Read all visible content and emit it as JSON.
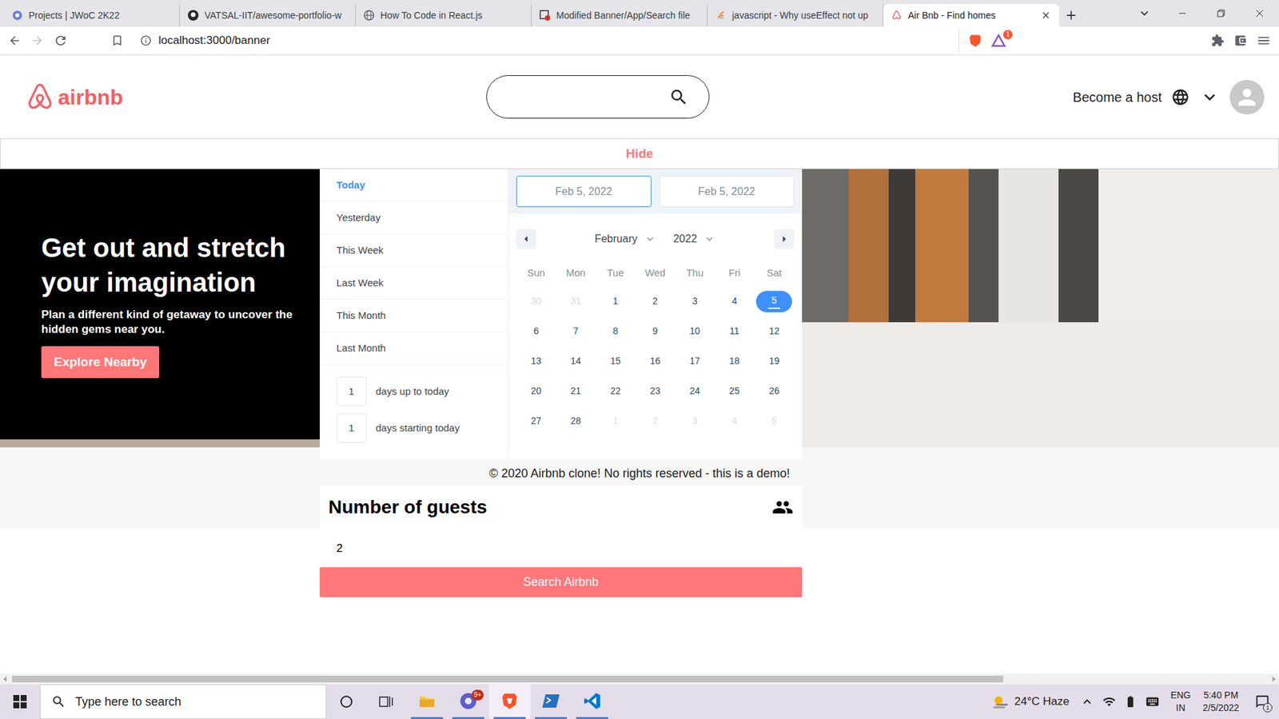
{
  "browser": {
    "tabs": [
      {
        "label": "Projects | JWoC 2K22",
        "selected": false,
        "kind": "jwoc"
      },
      {
        "label": "VATSAL-IIT/awesome-portfolio-w",
        "selected": false,
        "kind": "github"
      },
      {
        "label": "How To Code in React.js",
        "selected": false,
        "kind": "web"
      },
      {
        "label": "Modified Banner/App/Search file",
        "selected": false,
        "kind": "error"
      },
      {
        "label": "javascript - Why useEffect not up",
        "selected": false,
        "kind": "stackoverflow"
      },
      {
        "label": "Air Bnb - Find homes",
        "selected": true,
        "kind": "airbnb"
      }
    ],
    "address": "localhost:3000/banner",
    "rewards_badge": "1"
  },
  "header": {
    "logo": "airbnb",
    "search": {
      "value": ""
    },
    "host": "Become a host"
  },
  "hide_button": "Hide",
  "banner": {
    "title": "Get out and stretch your imagination",
    "subtitle": "Plan a different kind of getaway to uncover the hidden gems near you.",
    "button": "Explore Nearby"
  },
  "date_picker": {
    "ranges": [
      {
        "label": "Today",
        "selected": true
      },
      {
        "label": "Yesterday",
        "selected": false
      },
      {
        "label": "This Week",
        "selected": false
      },
      {
        "label": "Last Week",
        "selected": false
      },
      {
        "label": "This Month",
        "selected": false
      },
      {
        "label": "Last Month",
        "selected": false
      }
    ],
    "inputs": [
      {
        "value": "1",
        "label": "days up to today"
      },
      {
        "value": "1",
        "label": "days starting today"
      }
    ],
    "dates": [
      {
        "value": "Feb 5, 2022",
        "focused": true
      },
      {
        "value": "Feb 5, 2022",
        "focused": false
      }
    ],
    "month": "February",
    "year": "2022",
    "weekdays": [
      "Sun",
      "Mon",
      "Tue",
      "Wed",
      "Thu",
      "Fri",
      "Sat"
    ],
    "days": [
      {
        "label": "30",
        "muted": true,
        "selected": false,
        "today": false
      },
      {
        "label": "31",
        "muted": true,
        "selected": false,
        "today": false
      },
      {
        "label": "1",
        "muted": false,
        "selected": false,
        "today": false
      },
      {
        "label": "2",
        "muted": false,
        "selected": false,
        "today": false
      },
      {
        "label": "3",
        "muted": false,
        "selected": false,
        "today": false
      },
      {
        "label": "4",
        "muted": false,
        "selected": false,
        "today": false
      },
      {
        "label": "5",
        "muted": false,
        "selected": true,
        "today": true
      },
      {
        "label": "6",
        "muted": false,
        "selected": false,
        "today": false
      },
      {
        "label": "7",
        "muted": false,
        "selected": false,
        "today": false
      },
      {
        "label": "8",
        "muted": false,
        "selected": false,
        "today": false
      },
      {
        "label": "9",
        "muted": false,
        "selected": false,
        "today": false
      },
      {
        "label": "10",
        "muted": false,
        "selected": false,
        "today": false
      },
      {
        "label": "11",
        "muted": false,
        "selected": false,
        "today": false
      },
      {
        "label": "12",
        "muted": false,
        "selected": false,
        "today": false
      },
      {
        "label": "13",
        "muted": false,
        "selected": false,
        "today": false
      },
      {
        "label": "14",
        "muted": false,
        "selected": false,
        "today": false
      },
      {
        "label": "15",
        "muted": false,
        "selected": false,
        "today": false
      },
      {
        "label": "16",
        "muted": false,
        "selected": false,
        "today": false
      },
      {
        "label": "17",
        "muted": false,
        "selected": false,
        "today": false
      },
      {
        "label": "18",
        "muted": false,
        "selected": false,
        "today": false
      },
      {
        "label": "19",
        "muted": false,
        "selected": false,
        "today": false
      },
      {
        "label": "20",
        "muted": false,
        "selected": false,
        "today": false
      },
      {
        "label": "21",
        "muted": false,
        "selected": false,
        "today": false
      },
      {
        "label": "22",
        "muted": false,
        "selected": false,
        "today": false
      },
      {
        "label": "23",
        "muted": false,
        "selected": false,
        "today": false
      },
      {
        "label": "24",
        "muted": false,
        "selected": false,
        "today": false
      },
      {
        "label": "25",
        "muted": false,
        "selected": false,
        "today": false
      },
      {
        "label": "26",
        "muted": false,
        "selected": false,
        "today": false
      },
      {
        "label": "27",
        "muted": false,
        "selected": false,
        "today": false
      },
      {
        "label": "28",
        "muted": false,
        "selected": false,
        "today": false
      },
      {
        "label": "1",
        "muted": true,
        "selected": false,
        "today": false
      },
      {
        "label": "2",
        "muted": true,
        "selected": false,
        "today": false
      },
      {
        "label": "3",
        "muted": true,
        "selected": false,
        "today": false
      },
      {
        "label": "4",
        "muted": true,
        "selected": false,
        "today": false
      },
      {
        "label": "5",
        "muted": true,
        "selected": false,
        "today": false
      }
    ]
  },
  "footer": "© 2020 Airbnb clone! No rights reserved - this is a demo!",
  "guests": {
    "title": "Number of guests",
    "value": "2"
  },
  "search_button": "Search Airbnb",
  "scrollbar": {
    "level": 0.79
  },
  "taskbar": {
    "search": "Type here to search",
    "apps": [
      {
        "kind": "explorer",
        "running": true,
        "active": false,
        "badge": ""
      },
      {
        "kind": "chrome",
        "running": true,
        "active": false,
        "badge": "9+"
      },
      {
        "kind": "brave",
        "running": true,
        "active": true,
        "badge": ""
      },
      {
        "kind": "powershell",
        "running": true,
        "active": false,
        "badge": ""
      },
      {
        "kind": "vscode",
        "running": true,
        "active": false,
        "badge": ""
      }
    ],
    "weather": "24°C Haze",
    "lang": [
      "ENG",
      "IN"
    ],
    "time": "5:40 PM",
    "date": "2/5/2022",
    "notifications": "1"
  }
}
